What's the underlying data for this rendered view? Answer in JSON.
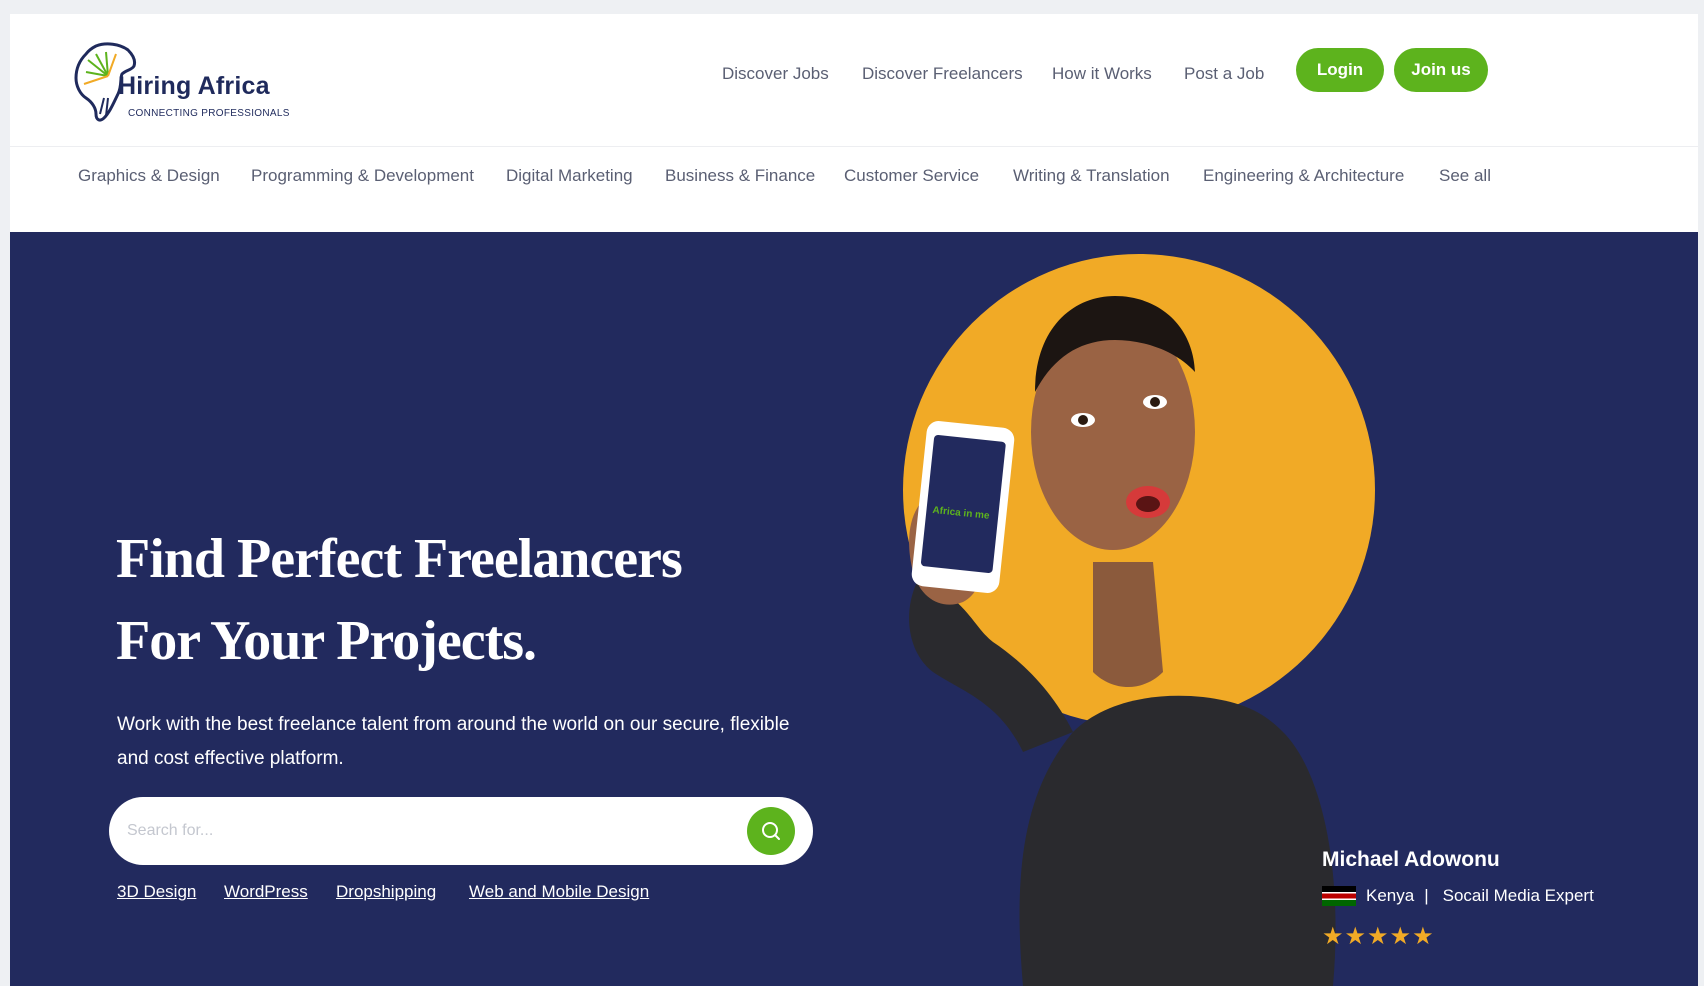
{
  "brand": {
    "name": "Hiring Africa",
    "tagline": "CONNECTING PROFESSIONALS"
  },
  "nav": {
    "links": [
      "Discover Jobs",
      "Discover Freelancers",
      "How it Works",
      "Post a Job"
    ],
    "login": "Login",
    "join": "Join us"
  },
  "categories": [
    "Graphics & Design",
    "Programming & Development",
    "Digital Marketing",
    "Business & Finance",
    "Customer Service",
    "Writing & Translation",
    "Engineering & Architecture",
    "See all"
  ],
  "hero": {
    "title_line1": "Find Perfect Freelancers",
    "title_line2": "For Your Projects.",
    "description": "Work with the best freelance talent from around the world on our secure, flexible and cost effective platform.",
    "search_placeholder": "Search for...",
    "tags": [
      "3D Design",
      "WordPress",
      "Dropshipping",
      "Web and Mobile Design"
    ]
  },
  "featured": {
    "name": "Michael Adowonu",
    "country": "Kenya",
    "separator": "|",
    "role": "Socail Media Expert",
    "rating": 5,
    "stars_text": "★★★★★",
    "phone_screen_text": "Africa in me"
  },
  "colors": {
    "navy": "#222a5e",
    "green": "#5db31d",
    "orange": "#f1aa26"
  }
}
